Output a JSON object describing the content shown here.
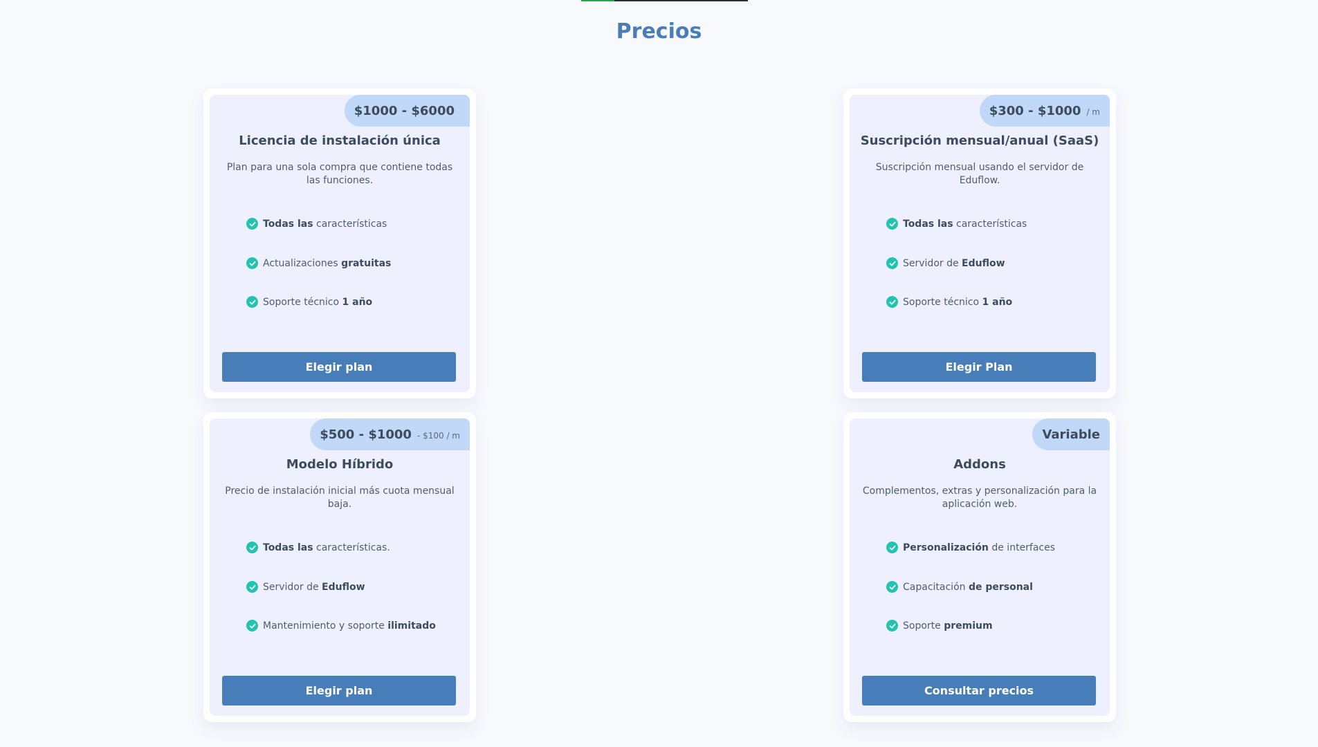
{
  "page": {
    "title": "Precios"
  },
  "plans": [
    {
      "price": "$1000 - $6000",
      "price_suffix": "",
      "title": "Licencia de instalación única",
      "description": "Plan para una sola compra que contiene todas las funciones.",
      "features": [
        {
          "bold": "Todas las",
          "text": " características"
        },
        {
          "text": "Actualizaciones ",
          "bold": "gratuitas"
        },
        {
          "text": "Soporte técnico ",
          "bold": "1 año"
        }
      ],
      "button": "Elegir plan"
    },
    {
      "price": "$300 - $1000",
      "price_suffix": "/ m",
      "title": "Suscripción mensual/anual (SaaS)",
      "description": "Suscripción mensual usando el servidor de Eduflow.",
      "features": [
        {
          "bold": "Todas las",
          "text": " características"
        },
        {
          "text": "Servidor de ",
          "bold": "Eduflow"
        },
        {
          "text": "Soporte técnico ",
          "bold": "1 año"
        }
      ],
      "button": "Elegir Plan"
    },
    {
      "price": "$500 - $1000",
      "price_suffix": "- $100 / m",
      "title": "Modelo Híbrido",
      "description": "Precio de instalación inicial más cuota mensual baja.",
      "features": [
        {
          "bold": "Todas las",
          "text": " características."
        },
        {
          "text": "Servidor de ",
          "bold": "Eduflow"
        },
        {
          "text": "Mantenimiento y soporte ",
          "bold": "ilimitado"
        }
      ],
      "button": "Elegir plan"
    },
    {
      "price": "Variable",
      "price_suffix": "",
      "title": "Addons",
      "description": "Complementos, extras y personalización para la aplicación web.",
      "features": [
        {
          "bold": "Personalización",
          "text": " de interfaces"
        },
        {
          "text": "Capacitación ",
          "bold": "de personal"
        },
        {
          "text": "Soporte ",
          "bold": "premium"
        }
      ],
      "button": "Consultar precios"
    }
  ],
  "colors": {
    "accent": "#4a7db8",
    "button": "#477eba",
    "badge": "#c1d8f8",
    "check": "#23c3b2",
    "card": "#eef1fd"
  },
  "icons": {
    "feature": "check-circle-icon"
  }
}
